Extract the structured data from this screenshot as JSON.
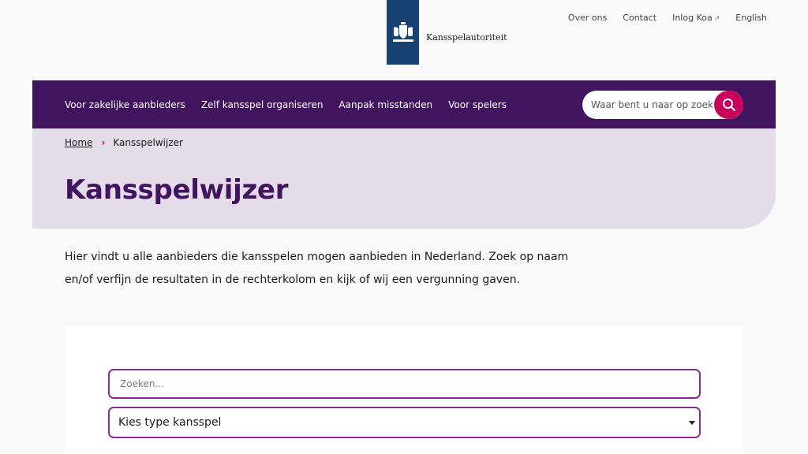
{
  "brand": {
    "name": "Kansspelautoriteit",
    "logo_color": "#154273",
    "logo_icon": "coat-of-arms-icon"
  },
  "utility_nav": {
    "items": [
      {
        "label": "Over ons"
      },
      {
        "label": "Contact"
      },
      {
        "label": "Inlog Koa",
        "icon": "external-link-icon"
      },
      {
        "label": "English"
      }
    ]
  },
  "main_nav": {
    "background": "#42145f",
    "items": [
      {
        "label": "Voor zakelijke aanbieders"
      },
      {
        "label": "Zelf kansspel organiseren"
      },
      {
        "label": "Aanpak misstanden"
      },
      {
        "label": "Voor spelers"
      }
    ],
    "search": {
      "placeholder": "Waar bent u naar op zoek?",
      "button_icon": "search-icon",
      "button_color": "#ca005d"
    }
  },
  "breadcrumb": {
    "home": "Home",
    "separator_icon": "chevron-right-icon",
    "current": "Kansspelwijzer"
  },
  "hero": {
    "title": "Kansspelwijzer",
    "background": "#e5dce9"
  },
  "intro": {
    "text": "Hier vindt u alle aanbieders die kansspelen mogen aanbieden in Nederland. Zoek op naam en/of verfijn de resultaten in de rechterkolom en kijk of wij een vergunning gaven."
  },
  "filter": {
    "search_placeholder": "Zoeken...",
    "type_select": {
      "selected": "Kies type kansspel",
      "icon": "caret-down-icon"
    },
    "border_color": "#8b2c8d"
  }
}
